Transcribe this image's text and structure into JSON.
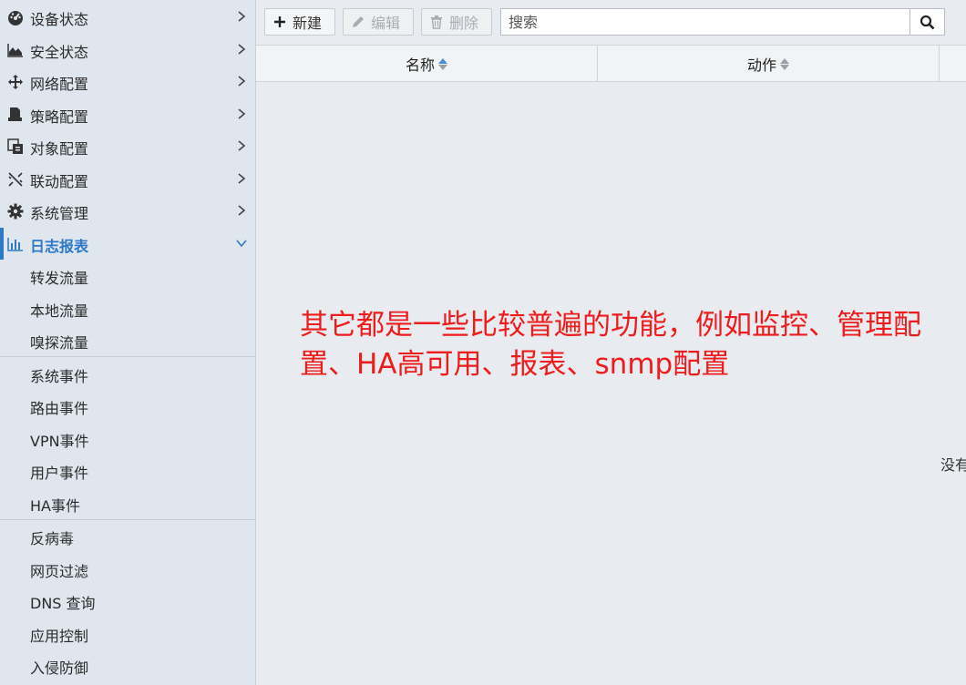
{
  "sidebar": {
    "menus": [
      {
        "label": "设备状态",
        "icon": "dashboard-icon"
      },
      {
        "label": "安全状态",
        "icon": "area-chart-icon"
      },
      {
        "label": "网络配置",
        "icon": "move-arrows-icon"
      },
      {
        "label": "策略配置",
        "icon": "document-stamp-icon"
      },
      {
        "label": "对象配置",
        "icon": "object-copy-icon"
      },
      {
        "label": "联动配置",
        "icon": "linkage-icon"
      },
      {
        "label": "系统管理",
        "icon": "gear-icon"
      },
      {
        "label": "日志报表",
        "icon": "bar-chart-icon",
        "active": true
      }
    ],
    "group1": [
      "转发流量",
      "本地流量",
      "嗅探流量"
    ],
    "group2": [
      "系统事件",
      "路由事件",
      "VPN事件",
      "用户事件",
      "HA事件"
    ],
    "group3": [
      "反病毒",
      "网页过滤",
      "DNS 查询",
      "应用控制",
      "入侵防御"
    ]
  },
  "toolbar": {
    "new_label": "新建",
    "edit_label": "编辑",
    "delete_label": "删除",
    "search_placeholder": "搜索"
  },
  "table": {
    "columns": [
      "名称",
      "动作"
    ],
    "empty_text": "没有"
  },
  "annotation": {
    "text": "其它都是一些比较普遍的功能，例如监控、管理配置、HA高可用、报表、snmp配置"
  },
  "colors": {
    "accent": "#2e78c6",
    "annotation": "#ee1c1c",
    "sidebar_bg": "#dfe6ee",
    "content_bg": "#e8ebef"
  }
}
